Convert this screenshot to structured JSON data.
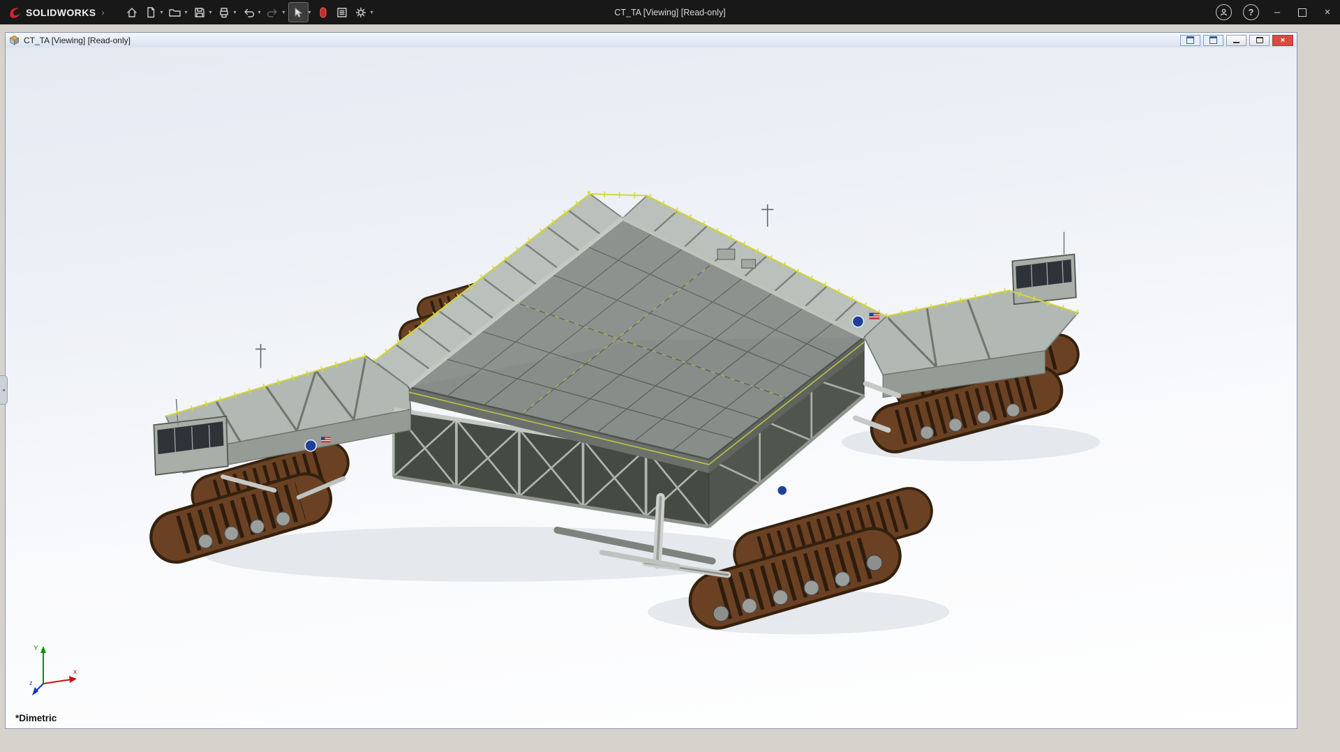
{
  "app": {
    "brand": "SOLIDWORKS",
    "brand_arrow": "›",
    "title": "CT_TA [Viewing] [Read-only]",
    "controls": {
      "minimize": "–",
      "close": "×"
    }
  },
  "toolbar": {
    "caret": "▾",
    "help": "?"
  },
  "doc_window": {
    "title": "CT_TA [Viewing] [Read-only]",
    "controls": {
      "close": "×"
    }
  },
  "viewport": {
    "orientation_label": "*Dimetric",
    "triad": {
      "x": "x",
      "y": "Y",
      "z": "z"
    }
  },
  "left_tab": {
    "glyph": "◂"
  },
  "colors": {
    "track_brown": "#6e4423",
    "deck_gray": "#878d89",
    "rail_yellow": "#d4d83a",
    "nasa_blue": "#1f3f9a",
    "close_red": "#d94a43",
    "brand_red": "#d8232a"
  }
}
